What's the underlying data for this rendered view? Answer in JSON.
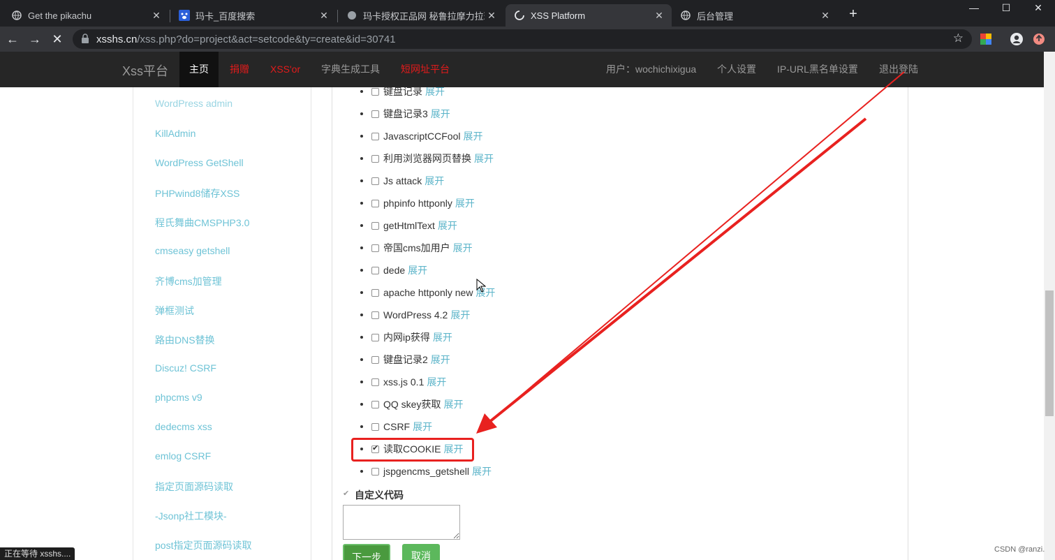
{
  "browser": {
    "tabs": [
      {
        "title": "Get the pikachu",
        "icon": "globe-icon"
      },
      {
        "title": "玛卡_百度搜索",
        "icon": "baidu-icon"
      },
      {
        "title": "玛卡授权正品网 秘鲁拉摩力拉玛",
        "icon": "globe-icon"
      },
      {
        "title": "XSS Platform",
        "icon": "loading-icon"
      },
      {
        "title": "后台管理",
        "icon": "globe-icon"
      }
    ],
    "url_domain": "xsshs.cn",
    "url_path": "/xss.php?do=project&act=setcode&ty=create&id=30741"
  },
  "site": {
    "brand": "Xss平台",
    "nav": [
      "主页",
      "捐赠",
      "XSS'or",
      "字典生成工具",
      "短网址平台"
    ],
    "user_label": "用户：wochichixigua",
    "right_nav": [
      "个人设置",
      "IP-URL黑名单设置",
      "退出登陆"
    ]
  },
  "sidebar": {
    "links": [
      "WordPress admin",
      "KillAdmin",
      "WordPress GetShell",
      "PHPwind8储存XSS",
      "程氏舞曲CMSPHP3.0",
      "cmseasy getshell",
      "齐博cms加管理",
      "弹框测试",
      "路由DNS替换",
      "Discuz! CSRF",
      "phpcms v9",
      "dedecms xss",
      "emlog CSRF",
      "指定页面源码读取",
      "-Jsonp社工模块-",
      "post指定页面源码读取"
    ]
  },
  "modules": {
    "expand_label": "展开",
    "items": [
      {
        "name": "键盘记录",
        "checked": false
      },
      {
        "name": "键盘记录3",
        "checked": false
      },
      {
        "name": "JavascriptCCFool",
        "checked": false
      },
      {
        "name": "利用浏览器网页替换",
        "checked": false
      },
      {
        "name": "Js attack",
        "checked": false
      },
      {
        "name": "phpinfo httponly",
        "checked": false
      },
      {
        "name": "getHtmlText",
        "checked": false
      },
      {
        "name": "帝国cms加用户",
        "checked": false
      },
      {
        "name": "dede",
        "checked": false
      },
      {
        "name": "apache httponly new",
        "checked": false
      },
      {
        "name": "WordPress 4.2",
        "checked": false
      },
      {
        "name": "内网ip获得",
        "checked": false
      },
      {
        "name": "键盘记录2",
        "checked": false
      },
      {
        "name": "xss.js 0.1",
        "checked": false
      },
      {
        "name": "QQ skey获取",
        "checked": false
      },
      {
        "name": "CSRF",
        "checked": false
      },
      {
        "name": "读取COOKIE",
        "checked": true
      },
      {
        "name": "jspgencms_getshell",
        "checked": false
      }
    ]
  },
  "custom_code": {
    "label": "自定义代码",
    "value": ""
  },
  "buttons": {
    "next": "下一步",
    "cancel": "取消"
  },
  "status_text": "正在等待 xsshs....",
  "watermark": "CSDN @ranzi.",
  "colors": {
    "annotation_red": "#e8211f",
    "link_blue": "#5bb4c9",
    "nav_red": "#e31b1b"
  }
}
